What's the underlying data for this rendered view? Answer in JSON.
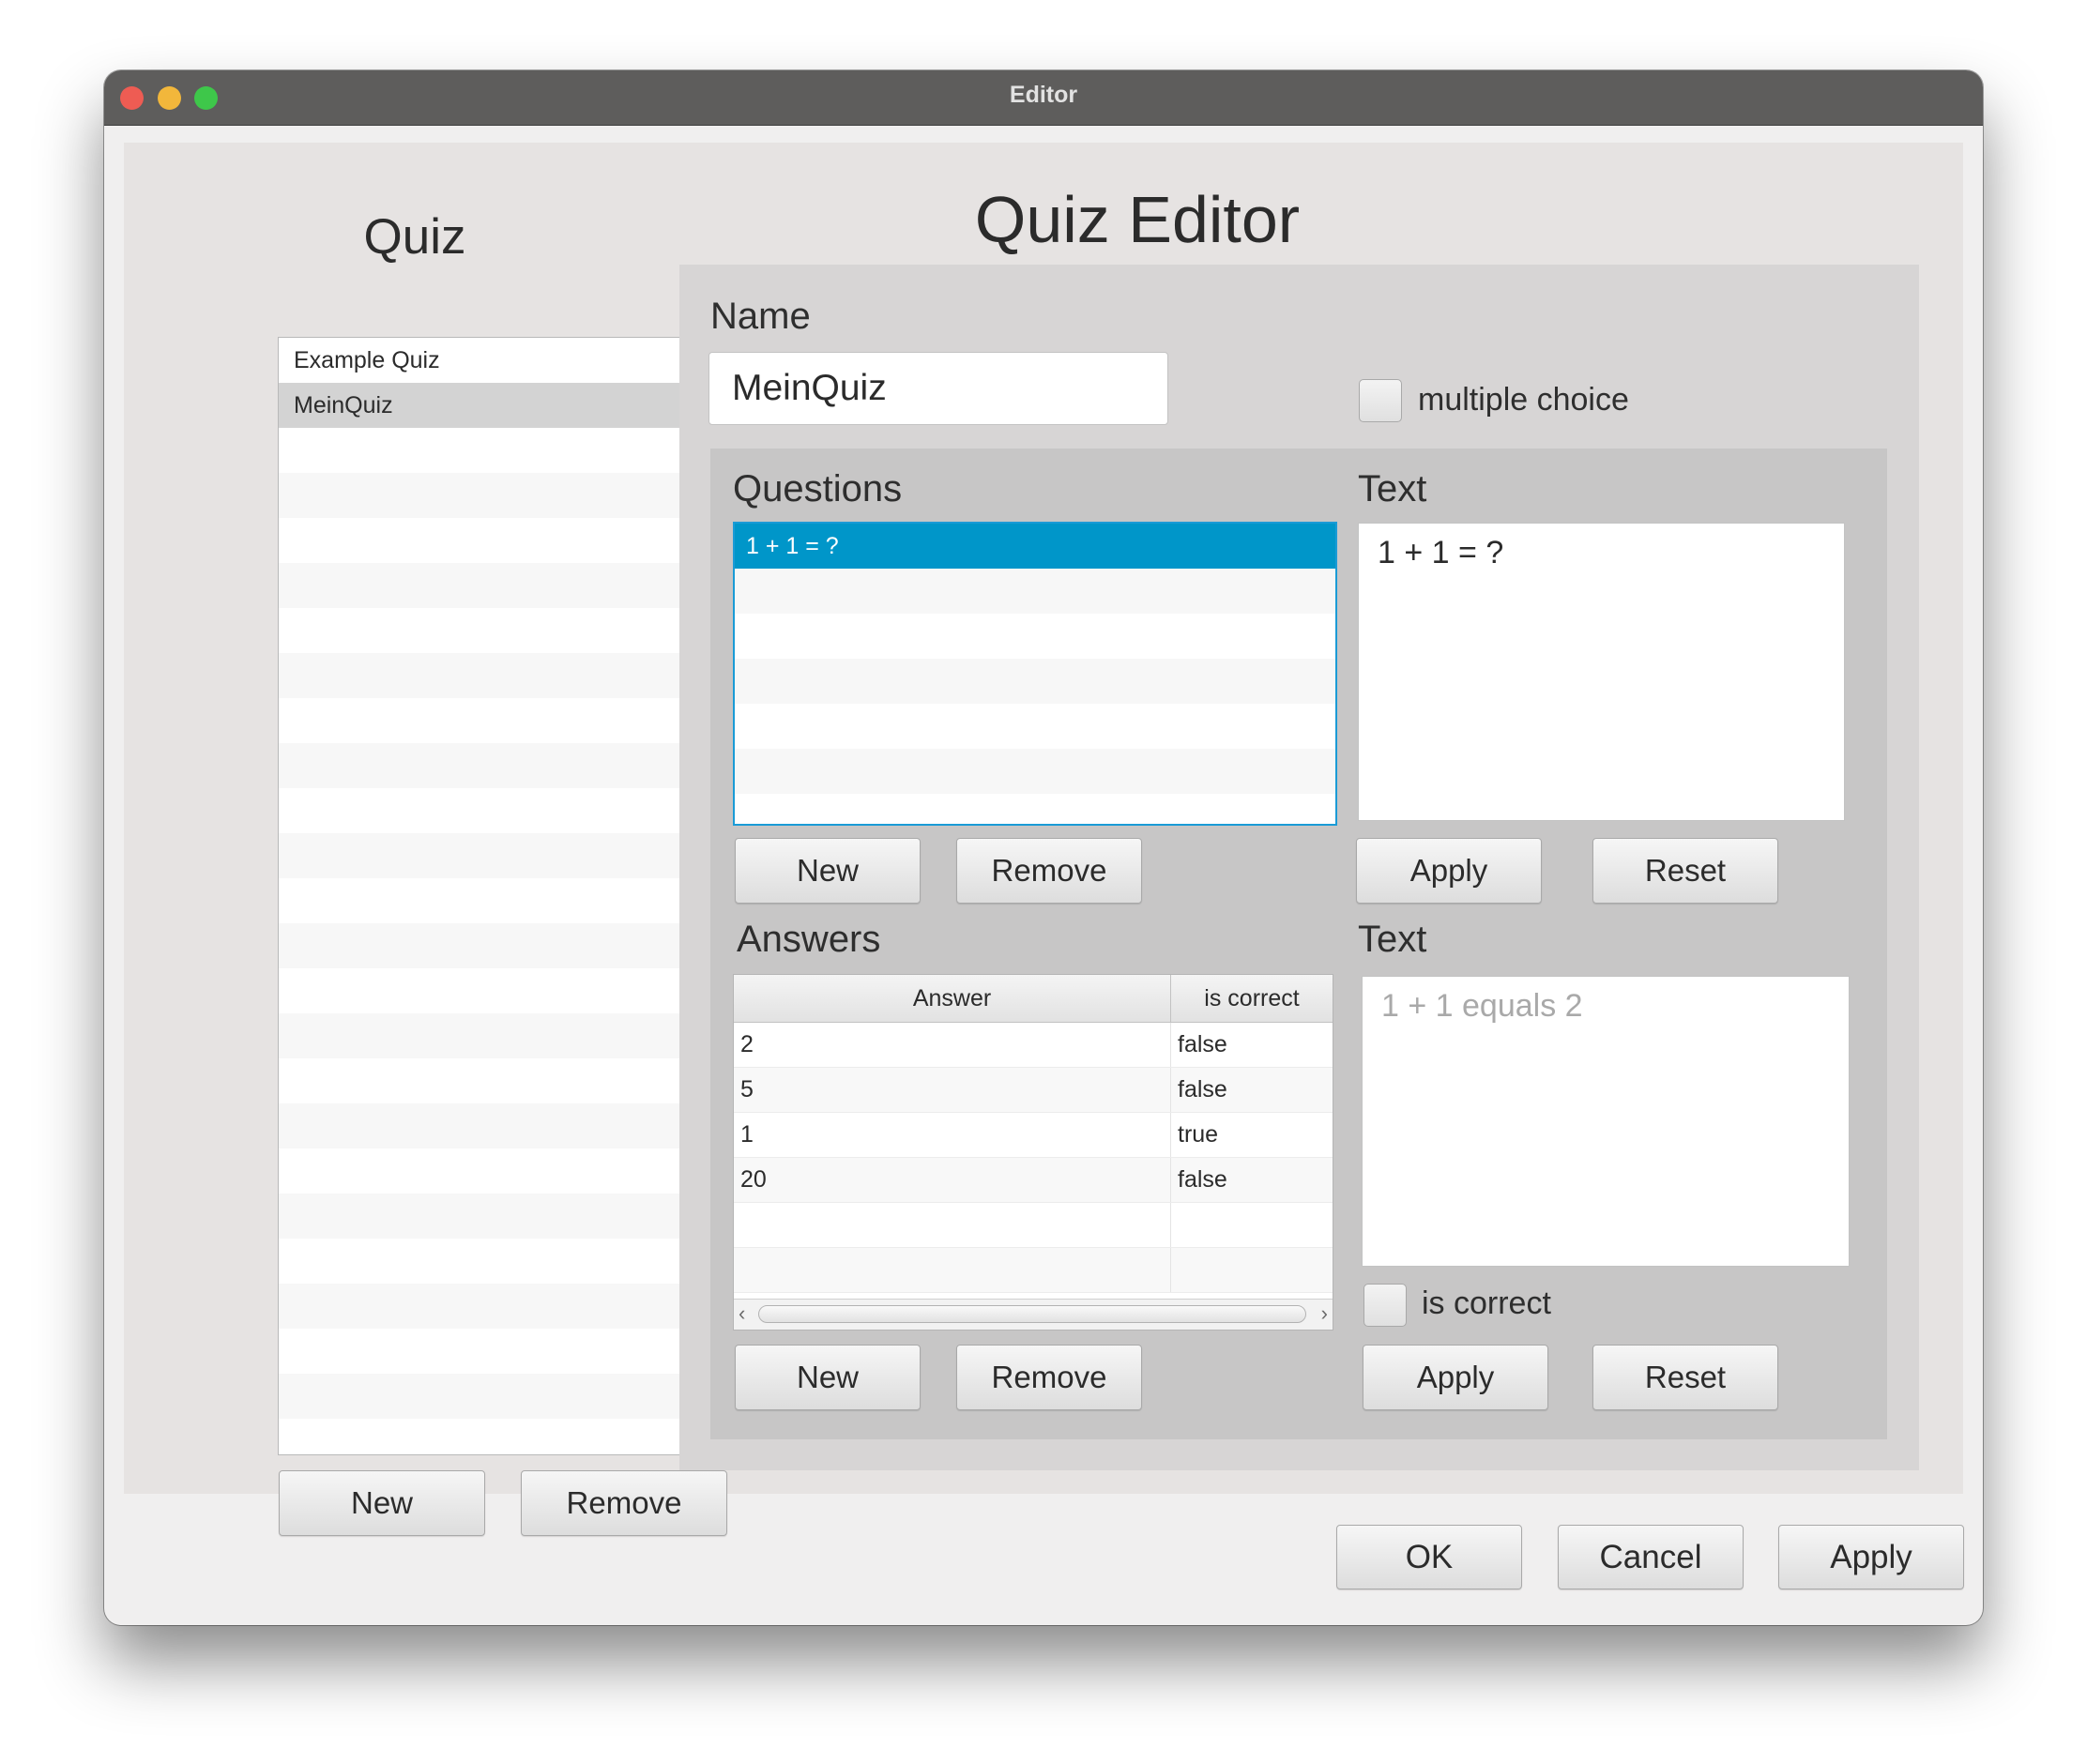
{
  "window": {
    "title": "Editor"
  },
  "quiz_panel": {
    "heading": "Quiz",
    "items": [
      "Example Quiz",
      "MeinQuiz"
    ],
    "selected_index": 1,
    "new_label": "New",
    "remove_label": "Remove"
  },
  "editor": {
    "heading": "Quiz Editor",
    "name_label": "Name",
    "name_value": "MeinQuiz",
    "multiple_choice_label": "multiple choice",
    "multiple_choice_checked": false,
    "questions": {
      "label": "Questions",
      "items": [
        "1 + 1 = ?"
      ],
      "selected_index": 0,
      "new_label": "New",
      "remove_label": "Remove"
    },
    "question_text": {
      "label": "Text",
      "value": "1 + 1 = ?",
      "apply_label": "Apply",
      "reset_label": "Reset"
    },
    "answers": {
      "label": "Answers",
      "columns": [
        "Answer",
        "is correct"
      ],
      "rows": [
        [
          "2",
          "false"
        ],
        [
          "5",
          "false"
        ],
        [
          "1",
          "true"
        ],
        [
          "20",
          "false"
        ]
      ],
      "new_label": "New",
      "remove_label": "Remove"
    },
    "answer_text": {
      "label": "Text",
      "placeholder": "1 + 1 equals 2",
      "is_correct_label": "is correct",
      "is_correct_checked": false,
      "apply_label": "Apply",
      "reset_label": "Reset"
    }
  },
  "dialog_buttons": {
    "ok": "OK",
    "cancel": "Cancel",
    "apply": "Apply"
  },
  "icons": {
    "scroll_left": "‹",
    "scroll_right": "›"
  },
  "colors": {
    "selection_blue": "#0096c9",
    "titlebar": "#5e5d5c"
  }
}
